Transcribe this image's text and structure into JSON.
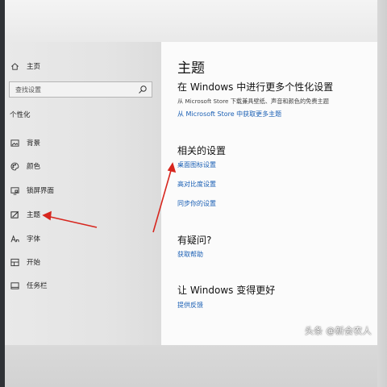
{
  "sidebar": {
    "home": "主页",
    "search_placeholder": "查找设置",
    "section": "个性化",
    "items": [
      {
        "label": "背景",
        "icon": "image-icon"
      },
      {
        "label": "颜色",
        "icon": "palette-icon"
      },
      {
        "label": "锁屏界面",
        "icon": "lock-screen-icon"
      },
      {
        "label": "主题",
        "icon": "theme-icon"
      },
      {
        "label": "字体",
        "icon": "font-icon"
      },
      {
        "label": "开始",
        "icon": "start-icon"
      },
      {
        "label": "任务栏",
        "icon": "taskbar-icon"
      }
    ],
    "active_item": "主题"
  },
  "content": {
    "title": "主题",
    "store_heading": "在 Windows 中进行更多个性化设置",
    "store_desc": "从 Microsoft Store 下载兼具壁纸、声音和颜色的免费主题",
    "store_link": "从 Microsoft Store 中获取更多主题",
    "related_heading": "相关的设置",
    "related_links": [
      "桌面图标设置",
      "高对比度设置",
      "同步你的设置"
    ],
    "question_heading": "有疑问?",
    "help_link": "获取帮助",
    "better_heading": "让 Windows 变得更好",
    "feedback_link": "提供反馈"
  },
  "watermark": "头条 @新会农人",
  "colors": {
    "link": "#1a5fb4",
    "arrow": "#d7261e",
    "sidebar_bg": "#e6e6e6",
    "content_bg": "#fbfbfb"
  }
}
